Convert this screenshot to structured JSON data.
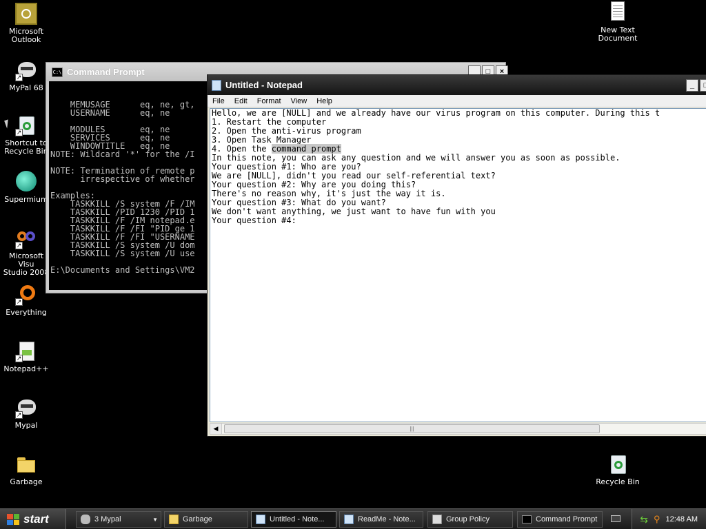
{
  "desktop_icons": [
    {
      "name": "microsoft-outlook",
      "label_lines": [
        "Microsoft",
        "Outlook"
      ]
    },
    {
      "name": "mypal-68",
      "label_lines": [
        "MyPal 68"
      ]
    },
    {
      "name": "shortcut-recycle-bin",
      "label_lines": [
        "Shortcut to",
        "Recycle Bin"
      ]
    },
    {
      "name": "supermium",
      "label_lines": [
        "Supermium"
      ]
    },
    {
      "name": "visual-studio",
      "label_lines": [
        "Microsoft Visu",
        "Studio 2008"
      ]
    },
    {
      "name": "everything",
      "label_lines": [
        "Everything"
      ]
    },
    {
      "name": "notepad-plus-plus",
      "label_lines": [
        "Notepad++"
      ]
    },
    {
      "name": "mypal",
      "label_lines": [
        "Mypal"
      ]
    },
    {
      "name": "garbage",
      "label_lines": [
        "Garbage"
      ]
    },
    {
      "name": "new-text-document",
      "label_lines": [
        "New Text",
        "Document"
      ]
    },
    {
      "name": "recycle-bin",
      "label_lines": [
        "Recycle Bin"
      ]
    }
  ],
  "cmd": {
    "title": "Command Prompt",
    "icon_text": "C:\\",
    "lines": [
      "",
      "",
      "    MEMUSAGE      eq, ne, gt,",
      "    USERNAME      eq, ne",
      "",
      "    MODULES       eq, ne",
      "    SERVICES      eq, ne",
      "    WINDOWTITLE   eq, ne",
      "NOTE: Wildcard '*' for the /I",
      "",
      "NOTE: Termination of remote p",
      "      irrespective of whether",
      "",
      "Examples:",
      "    TASKKILL /S system /F /IM",
      "    TASKKILL /PID 1230 /PID 1",
      "    TASKKILL /F /IM notepad.e",
      "    TASKKILL /F /FI \"PID ge 1",
      "    TASKKILL /F /FI \"USERNAME",
      "    TASKKILL /S system /U dom",
      "    TASKKILL /S system /U use",
      "",
      "E:\\Documents and Settings\\VM2"
    ]
  },
  "notepad": {
    "title": "Untitled - Notepad",
    "menu": [
      "File",
      "Edit",
      "Format",
      "View",
      "Help"
    ],
    "line1": "Hello, we are [NULL] and we already have our virus program on this computer. During this t",
    "line2": "1. Restart the computer",
    "line3": "2. Open the anti-virus program",
    "line4": "3. Open Task Manager",
    "line5_prefix": "4. Open the ",
    "line5_selected": "command prompt",
    "line6": "In this note, you can ask any question and we will answer you as soon as possible.",
    "line7": "Your question #1: Who are you?",
    "line8": "We are [NULL], didn't you read our self-referential text?",
    "line9": "Your question #2: Why are you doing this?",
    "line10": "There's no reason why, it's just the way it is.",
    "line11": "Your question #3: What do you want?",
    "line12": "We don't want anything, we just want to have fun with you",
    "line13": "Your question #4:"
  },
  "taskbar": {
    "start_label": "start",
    "tasks": [
      {
        "label": "3 Mypal",
        "name": "task-mypal"
      },
      {
        "label": "Garbage",
        "name": "task-garbage"
      },
      {
        "label": "Untitled - Note...",
        "name": "task-notepad-untitled"
      },
      {
        "label": "ReadMe - Note...",
        "name": "task-notepad-readme"
      },
      {
        "label": "Group Policy",
        "name": "task-group-policy"
      },
      {
        "label": "Command Prompt",
        "name": "task-command-prompt"
      }
    ],
    "clock": "12:48 AM"
  }
}
